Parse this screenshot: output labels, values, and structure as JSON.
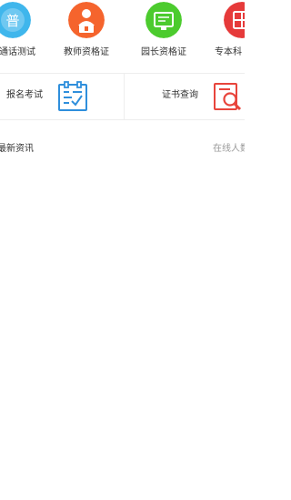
{
  "categories": [
    {
      "label": "普通话测试",
      "icon": "putonghua-icon",
      "icon_text": "普",
      "color": "#3fb6ec"
    },
    {
      "label": "教师资格证",
      "icon": "teacher-icon",
      "color": "#f5642d"
    },
    {
      "label": "园长资格证",
      "icon": "certificate-icon",
      "color": "#4ccb2e"
    },
    {
      "label": "专本科",
      "icon": "degree-icon",
      "color": "#e63a3a"
    }
  ],
  "entries": [
    {
      "label": "报名考试",
      "icon": "registration-form-icon",
      "color": "#2f8fdc"
    },
    {
      "label": "证书查询",
      "icon": "certificate-search-icon",
      "color": "#e8453c"
    }
  ],
  "news": {
    "title": "最新资讯",
    "online": "在线人数"
  }
}
